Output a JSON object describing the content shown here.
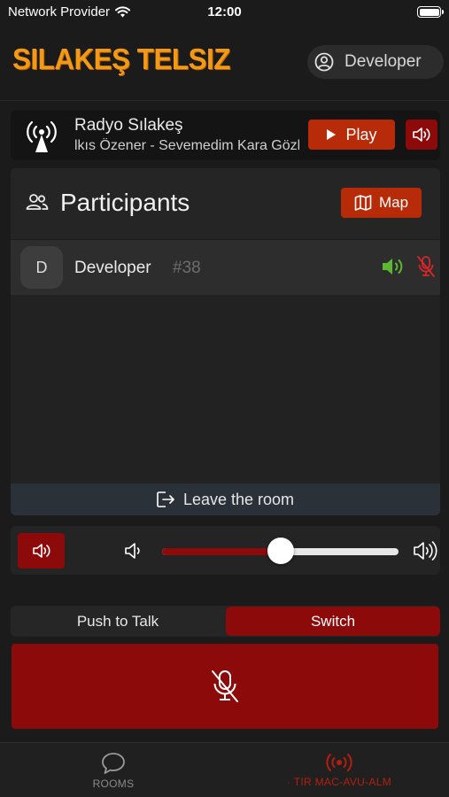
{
  "status_bar": {
    "carrier": "Network Provider",
    "time": "12:00",
    "battery_level_percent": 100
  },
  "header": {
    "logo_text": "SILAKEŞ TELSIZ",
    "user_name": "Developer"
  },
  "radio": {
    "station": "Radyo Sılakeş",
    "now_playing": "lkıs Özener - Sevemedim Kara Gözlüm",
    "play_label": "Play"
  },
  "participants": {
    "title": "Participants",
    "map_label": "Map",
    "list": [
      {
        "initial": "D",
        "name": "Developer",
        "id": "#38"
      }
    ],
    "leave_label": "Leave the room"
  },
  "volume": {
    "level_percent": 50
  },
  "mode": {
    "options": [
      "Push to Talk",
      "Switch"
    ],
    "selected": "Switch"
  },
  "tabs": {
    "rooms_label": "ROOMS",
    "current_room_label": "· TIR MAC-AVU-ALM"
  },
  "colors": {
    "accent": "#b82b08",
    "dark_red": "#8c0a0a",
    "speaking_green": "#5cb82f",
    "muted_red": "#d8262b",
    "logo_orange": "#f29a16"
  },
  "icons": {
    "wifi": "wifi-icon",
    "battery": "battery-icon",
    "user": "user-circle-icon",
    "radio": "radio-tower-icon",
    "play": "play-icon",
    "speaker": "speaker-icon",
    "people": "people-icon",
    "map": "map-icon",
    "mic_off": "mic-off-icon",
    "leave": "exit-icon",
    "rooms": "chat-bubble-icon",
    "broadcast": "broadcast-icon"
  }
}
